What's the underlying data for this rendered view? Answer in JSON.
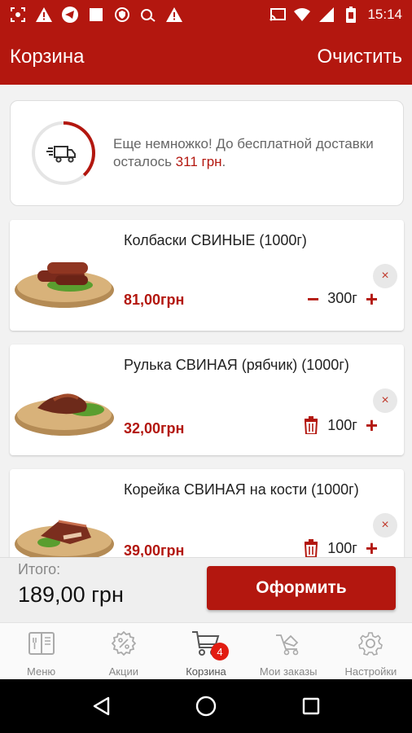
{
  "status_bar": {
    "time": "15:14",
    "left_icons": [
      "screenshot-icon",
      "warning-icon",
      "telegram-icon",
      "square-icon",
      "shield-icon",
      "translate-icon",
      "warning-icon"
    ],
    "right_icons": [
      "cast-icon",
      "wifi-icon",
      "signal-icon",
      "battery-icon"
    ]
  },
  "app_bar": {
    "title": "Корзина",
    "clear_label": "Очистить"
  },
  "promo": {
    "line_text": "Еще немножко! До бесплатной доставки осталось",
    "amount": "311 грн",
    "suffix": ".",
    "progress": 0.38,
    "icon": "delivery-truck-icon"
  },
  "items": [
    {
      "name": "Колбаски СВИНЫЕ (1000г)",
      "price": "81,00грн",
      "quantity": "300г",
      "minus_icon": "minus-icon",
      "plus_icon": "plus-icon"
    },
    {
      "name": "Рулька СВИНАЯ (рябчик) (1000г)",
      "price": "32,00грн",
      "quantity": "100г",
      "minus_icon": "trash-icon",
      "plus_icon": "plus-icon"
    },
    {
      "name": "Корейка СВИНАЯ на кости (1000г)",
      "price": "39,00грн",
      "quantity": "100г",
      "minus_icon": "trash-icon",
      "plus_icon": "plus-icon"
    }
  ],
  "remove_symbol": "×",
  "minus_symbol": "−",
  "plus_symbol": "+",
  "total": {
    "label": "Итого:",
    "value": "189,00 грн",
    "checkout_label": "Оформить"
  },
  "tabs": [
    {
      "label": "Меню",
      "icon": "menu-book-icon"
    },
    {
      "label": "Акции",
      "icon": "discount-icon"
    },
    {
      "label": "Корзина",
      "icon": "cart-icon",
      "badge": "4",
      "active": true
    },
    {
      "label": "Мои заказы",
      "icon": "orders-cart-icon"
    },
    {
      "label": "Настройки",
      "icon": "settings-gear-icon"
    }
  ],
  "colors": {
    "primary": "#b3170f",
    "badge": "#e21d12",
    "text_dark": "#222222",
    "text_muted": "#888888"
  }
}
